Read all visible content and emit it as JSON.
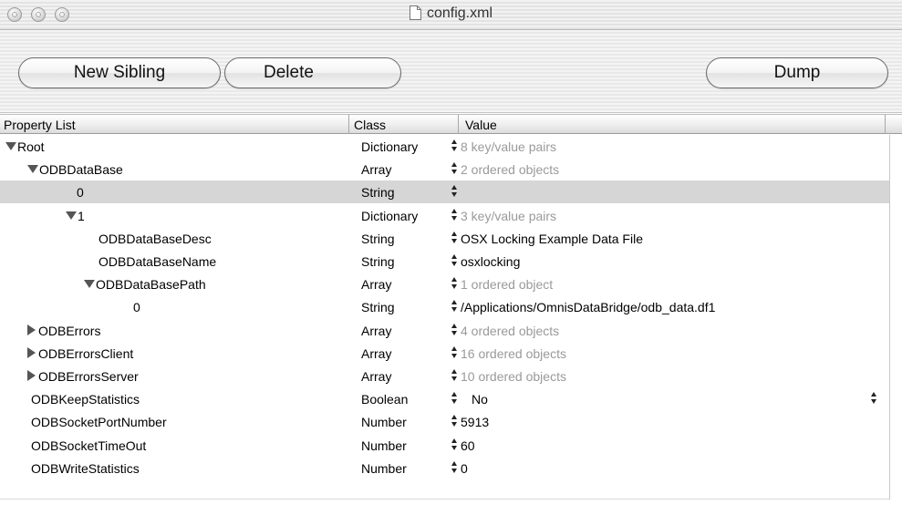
{
  "window": {
    "title": "config.xml"
  },
  "toolbar": {
    "new_sibling_label": "New Sibling",
    "delete_label": "Delete",
    "dump_label": "Dump"
  },
  "columns": {
    "property": "Property List",
    "class": "Class",
    "value": "Value"
  },
  "rows": [
    {
      "key": "Root",
      "class": "Dictionary",
      "value": "8 key/value pairs",
      "value_style": "gray",
      "disclosure": "expanded",
      "indent": 1
    },
    {
      "key": "ODBDataBase",
      "class": "Array",
      "value": "2 ordered objects",
      "value_style": "gray",
      "disclosure": "expanded",
      "indent": 2
    },
    {
      "key": "0",
      "class": "String",
      "value": "",
      "value_style": "normal",
      "disclosure": "none",
      "indent": 3,
      "selected": true
    },
    {
      "key": "1",
      "class": "Dictionary",
      "value": "3 key/value pairs",
      "value_style": "gray",
      "disclosure": "expanded",
      "indent": 3
    },
    {
      "key": "ODBDataBaseDesc",
      "class": "String",
      "value": "OSX Locking Example Data File",
      "value_style": "normal",
      "disclosure": "none",
      "indent": 4
    },
    {
      "key": "ODBDataBaseName",
      "class": "String",
      "value": "osxlocking",
      "value_style": "normal",
      "disclosure": "none",
      "indent": 4
    },
    {
      "key": "ODBDataBasePath",
      "class": "Array",
      "value": "1 ordered object",
      "value_style": "gray",
      "disclosure": "expanded",
      "indent": 4
    },
    {
      "key": "0",
      "class": "String",
      "value": "/Applications/OmnisDataBridge/odb_data.df1",
      "value_style": "normal",
      "disclosure": "none",
      "indent": 5
    },
    {
      "key": "ODBErrors",
      "class": "Array",
      "value": "4 ordered objects",
      "value_style": "gray",
      "disclosure": "collapsed",
      "indent": 2
    },
    {
      "key": "ODBErrorsClient",
      "class": "Array",
      "value": "16 ordered objects",
      "value_style": "gray",
      "disclosure": "collapsed",
      "indent": 2
    },
    {
      "key": "ODBErrorsServer",
      "class": "Array",
      "value": "10 ordered objects",
      "value_style": "gray",
      "disclosure": "collapsed",
      "indent": 2
    },
    {
      "key": "ODBKeepStatistics",
      "class": "Boolean",
      "value": "No",
      "value_style": "popup",
      "disclosure": "none",
      "indent": 2
    },
    {
      "key": "ODBSocketPortNumber",
      "class": "Number",
      "value": "5913",
      "value_style": "normal",
      "disclosure": "none",
      "indent": 2
    },
    {
      "key": "ODBSocketTimeOut",
      "class": "Number",
      "value": "60",
      "value_style": "normal",
      "disclosure": "none",
      "indent": 2
    },
    {
      "key": "ODBWriteStatistics",
      "class": "Number",
      "value": "0",
      "value_style": "normal",
      "disclosure": "none",
      "indent": 2
    }
  ]
}
